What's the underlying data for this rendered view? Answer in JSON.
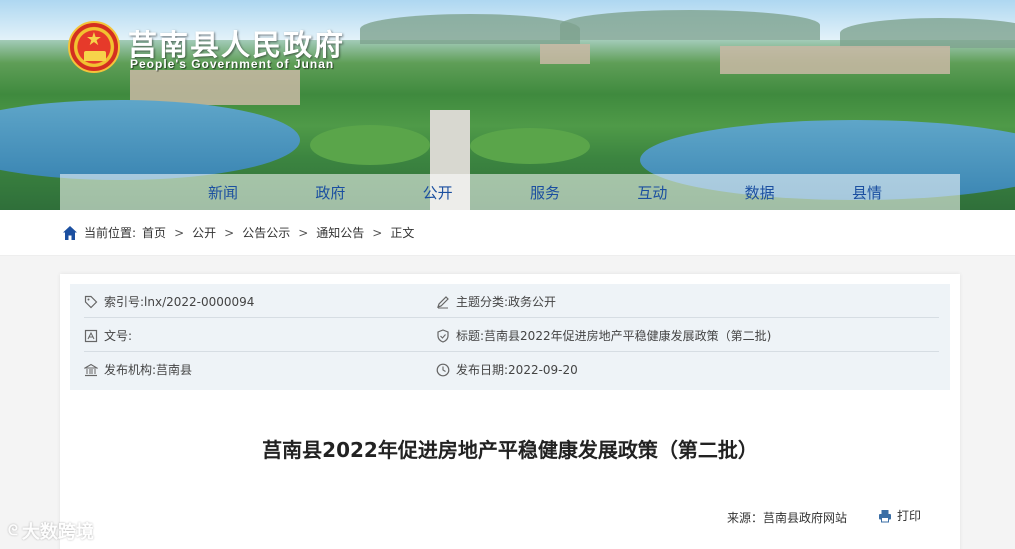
{
  "header": {
    "title": "莒南县人民政府",
    "subtitle": "People's Government of Junan"
  },
  "nav": [
    "新闻",
    "政府",
    "公开",
    "服务",
    "互动",
    "数据",
    "县情"
  ],
  "breadcrumb": {
    "label": "当前位置:",
    "items": [
      "首页",
      "公开",
      "公告公示",
      "通知公告",
      "正文"
    ],
    "separator": ">"
  },
  "meta": {
    "index_label": "索引号:",
    "index_value": "lnx/2022-0000094",
    "topic_label": "主题分类:",
    "topic_value": "政务公开",
    "docno_label": "文号:",
    "docno_value": "",
    "title_label": "标题:",
    "title_value": "莒南县2022年促进房地产平稳健康发展政策（第二批)",
    "org_label": "发布机构:",
    "org_value": "莒南县",
    "date_label": "发布日期:",
    "date_value": "2022-09-20"
  },
  "article": {
    "title": "莒南县2022年促进房地产平稳健康发展政策（第二批）",
    "source": "来源：莒南县政府网站",
    "print_label": "打印"
  },
  "watermark": "大数跨境",
  "colors": {
    "nav_text": "#1b4fa0",
    "home_icon": "#1b4fa0"
  }
}
